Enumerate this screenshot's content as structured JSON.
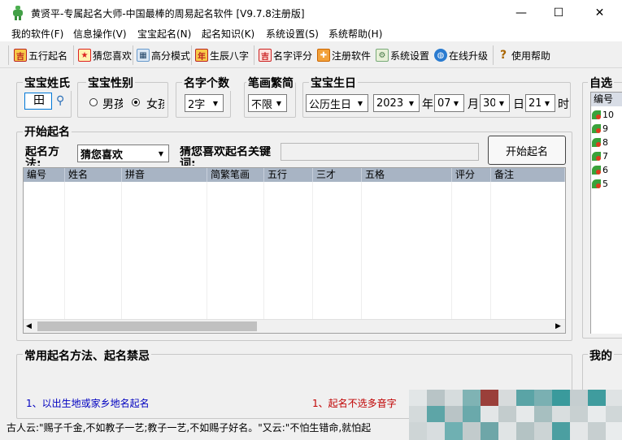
{
  "window": {
    "title": "黄贤平-专属起名大师-中国最棒的周易起名软件 [V9.7.8注册版]",
    "minimize": "—",
    "maximize": "☐",
    "close": "✕"
  },
  "menu": [
    "我的软件(F)",
    "信息操作(V)",
    "宝宝起名(N)",
    "起名知识(K)",
    "系统设置(S)",
    "系统帮助(H)"
  ],
  "toolbar": {
    "wuxing": "五行起名",
    "guess": "猜您喜欢",
    "high": "高分模式",
    "bazi": "生辰八字",
    "score": "名字评分",
    "register": "注册软件",
    "settings": "系统设置",
    "upgrade": "在线升级",
    "help": "使用帮助"
  },
  "surname": {
    "label": "宝宝姓氏",
    "value": "田"
  },
  "gender": {
    "label": "宝宝性别",
    "male": "男孩",
    "female": "女孩",
    "selected": "female"
  },
  "count": {
    "label": "名字个数",
    "value": "2字"
  },
  "strokes": {
    "label": "笔画繁简",
    "value": "不限"
  },
  "birthday": {
    "label": "宝宝生日",
    "calendar": "公历生日",
    "year": "2023",
    "year_unit": "年",
    "month": "07",
    "month_unit": "月",
    "day": "30",
    "day_unit": "日",
    "hour": "21",
    "hour_unit": "时"
  },
  "start": {
    "group_label": "开始起名",
    "method_label": "起名方法:",
    "method_value": "猜您喜欢",
    "keyword_label": "猜您喜欢起名关键词:",
    "keyword_value": "",
    "button": "开始起名"
  },
  "table": {
    "columns": [
      "编号",
      "姓名",
      "拼音",
      "简繁笔画",
      "五行",
      "三才",
      "五格",
      "评分",
      "备注"
    ]
  },
  "right_panel": {
    "label": "自选",
    "header": "编号",
    "items": [
      "10",
      "9",
      "8",
      "7",
      "6",
      "5"
    ]
  },
  "common": {
    "label": "常用起名方法、起名禁忌",
    "left_item": "1、以出生地或家乡地名起名",
    "right_item": "1、起名不选多音字"
  },
  "my_label": "我的",
  "status": "古人云:\"赐子千金,不如教子一艺;教子一艺,不如赐子好名。\"又云:\"不怕生错命,就怕起",
  "colors": {
    "header_bg": "#a8b4c4",
    "blue_text": "#0000c0",
    "red_text": "#c00000"
  }
}
